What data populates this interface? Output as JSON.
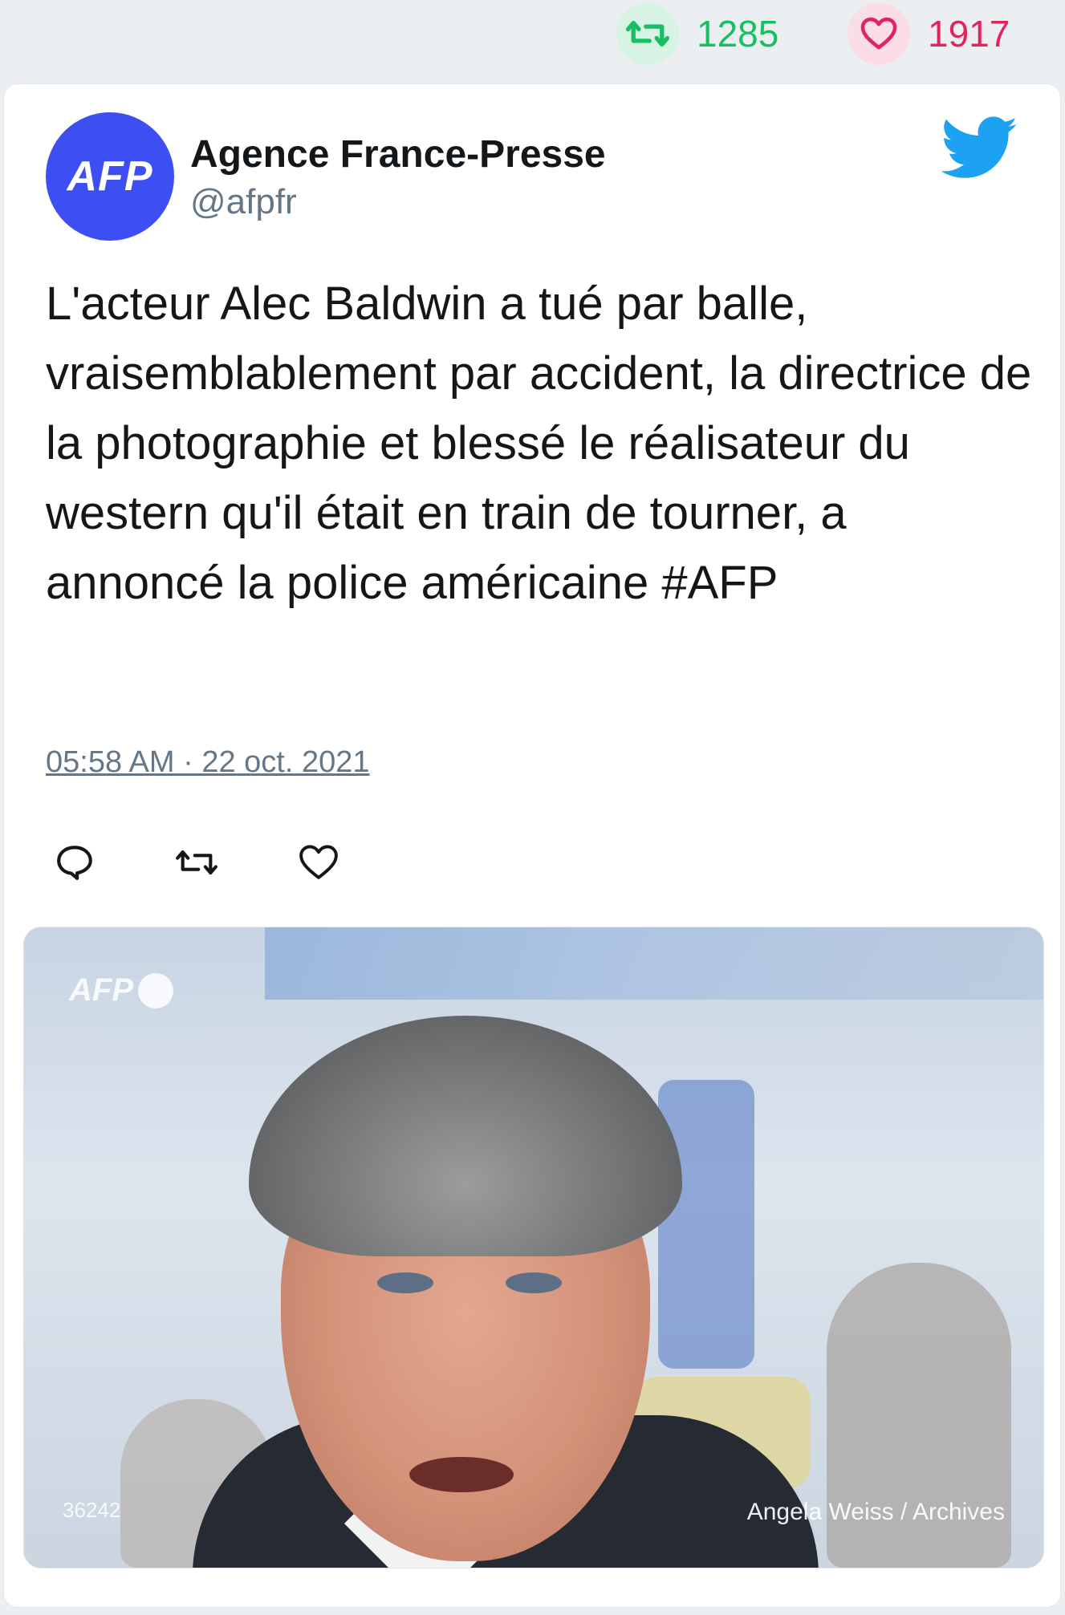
{
  "stats": {
    "retweet_count": "1285",
    "like_count": "1917",
    "retweet_icon": "retweet-icon",
    "like_icon": "heart-icon"
  },
  "tweet": {
    "avatar_text": "AFP",
    "author_name": "Agence France-Presse",
    "author_handle": "@afpfr",
    "text": "L'acteur Alec Baldwin a tué par balle, vraisemblablement par accident, la directrice de la photographie et blessé le réalisateur du western qu'il était en train de tourner, a annoncé la police américaine #AFP",
    "timestamp": "05:58 AM · 22 oct. 2021",
    "actions": [
      "reply-icon",
      "retweet-icon",
      "heart-icon"
    ]
  },
  "media": {
    "watermark": "AFP",
    "image_id": "36242",
    "credit": "Angela Weiss / Archives"
  },
  "colors": {
    "retweet": "#17bf63",
    "like": "#e0245e",
    "twitter_blue": "#1da1f2",
    "avatar_bg": "#3d4ff2"
  }
}
